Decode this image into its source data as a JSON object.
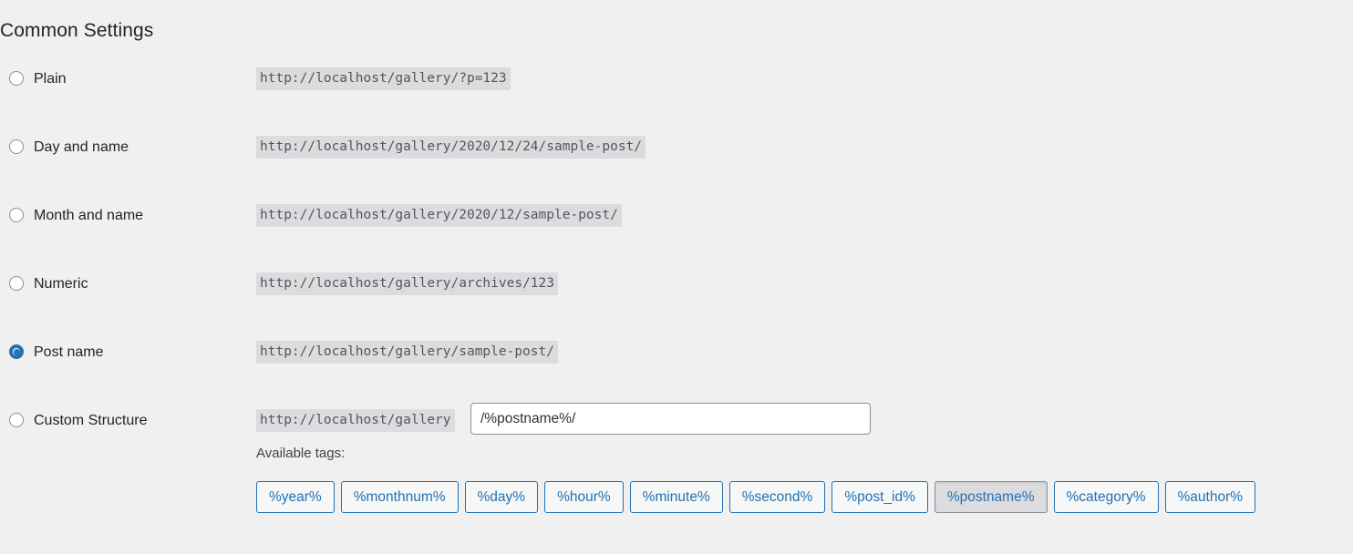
{
  "heading": "Common Settings",
  "options": [
    {
      "id": "plain",
      "label": "Plain",
      "url": "http://localhost/gallery/?p=123",
      "selected": false
    },
    {
      "id": "day-and-name",
      "label": "Day and name",
      "url": "http://localhost/gallery/2020/12/24/sample-post/",
      "selected": false
    },
    {
      "id": "month-and-name",
      "label": "Month and name",
      "url": "http://localhost/gallery/2020/12/sample-post/",
      "selected": false
    },
    {
      "id": "numeric",
      "label": "Numeric",
      "url": "http://localhost/gallery/archives/123",
      "selected": false
    },
    {
      "id": "post-name",
      "label": "Post name",
      "url": "http://localhost/gallery/sample-post/",
      "selected": true
    }
  ],
  "custom": {
    "label": "Custom Structure",
    "selected": false,
    "base_url": "http://localhost/gallery",
    "input_value": "/%postname%/",
    "input_placeholder": ""
  },
  "available_tags_label": "Available tags:",
  "tags": [
    {
      "label": "%year%",
      "active": false
    },
    {
      "label": "%monthnum%",
      "active": false
    },
    {
      "label": "%day%",
      "active": false
    },
    {
      "label": "%hour%",
      "active": false
    },
    {
      "label": "%minute%",
      "active": false
    },
    {
      "label": "%second%",
      "active": false
    },
    {
      "label": "%post_id%",
      "active": false
    },
    {
      "label": "%postname%",
      "active": true
    },
    {
      "label": "%category%",
      "active": false
    },
    {
      "label": "%author%",
      "active": false
    }
  ],
  "colors": {
    "page_background": "#f0f0f1",
    "accent": "#2271b1",
    "code_background": "#dcdcde",
    "heading_text": "#1d2327",
    "body_text": "#3c434a",
    "border_gray": "#8c8f94"
  }
}
